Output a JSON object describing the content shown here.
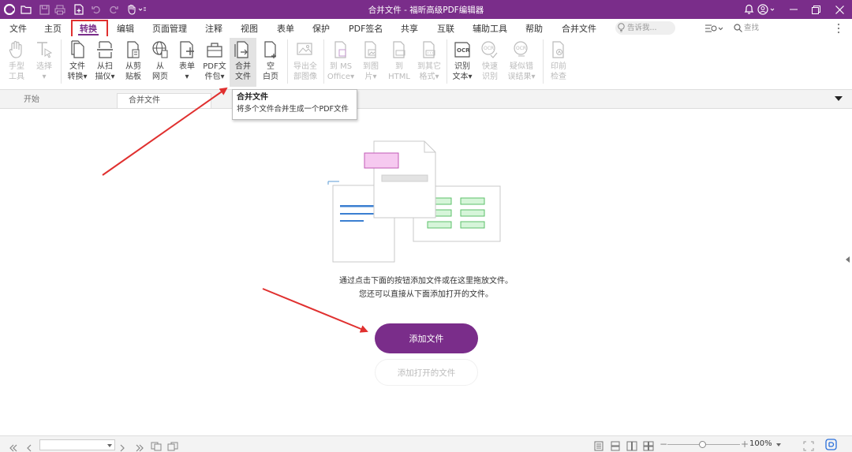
{
  "window": {
    "title": "合并文件 - 福昕高级PDF编辑器"
  },
  "menu": {
    "tabs": [
      "文件",
      "主页",
      "转换",
      "编辑",
      "页面管理",
      "注释",
      "视图",
      "表单",
      "保护",
      "PDF签名",
      "共享",
      "互联",
      "辅助工具",
      "帮助",
      "合并文件"
    ],
    "active": "转换",
    "tell_me_placeholder": "告诉我...",
    "search_placeholder": "查找"
  },
  "ribbon": {
    "hand_tool": "手型\n工具",
    "select": "选择",
    "file_convert": "文件\n转换▾",
    "from_scanner": "从扫\n描仪▾",
    "from_clipboard": "从剪\n贴板",
    "from_web": "从\n网页",
    "form": "表单",
    "pdf_portfolio": "PDF文\n件包▾",
    "merge_files": "合并\n文件",
    "blank_page": "空\n白页",
    "export_images": "导出全\n部图像",
    "to_ms_office": "到 MS\nOffice▾",
    "to_image": "到图\n片▾",
    "to_html": "到\nHTML",
    "to_other": "到其它\n格式▾",
    "ocr_text": "识别\n文本▾",
    "quick_ocr": "快速\n识别",
    "suspect_results": "疑似错\n误结果▾",
    "preflight": "印前\n检查"
  },
  "tooltip": {
    "title": "合并文件",
    "desc": "将多个文件合并生成一个PDF文件"
  },
  "doc_tabs": {
    "start": "开始",
    "current": "合并文件"
  },
  "main": {
    "hint_line1": "通过点击下面的按钮添加文件或在这里拖放文件。",
    "hint_line2": "您还可以直接从下面添加打开的文件。",
    "add_files_button": "添加文件",
    "add_open_files_button": "添加打开的文件"
  },
  "statusbar": {
    "zoom": "100%"
  },
  "colors": {
    "brand": "#7a2d8a",
    "annotation": "#e0302f"
  }
}
